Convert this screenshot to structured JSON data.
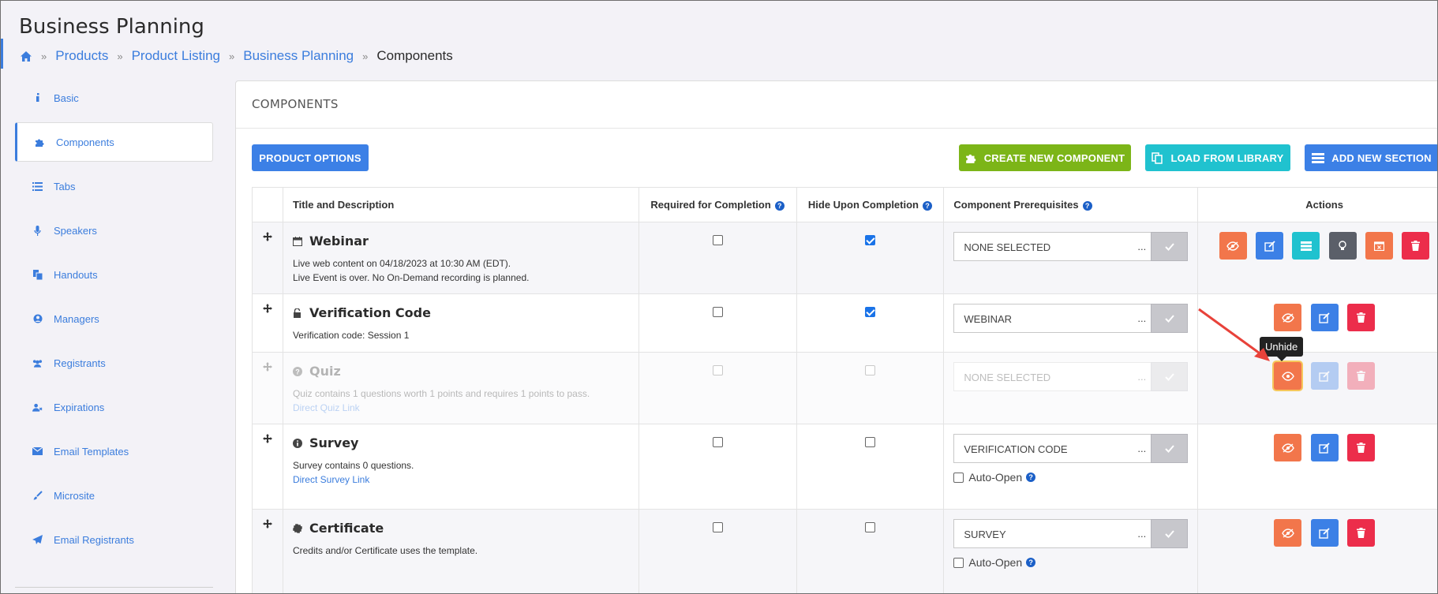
{
  "header": {
    "title": "Business Planning"
  },
  "breadcrumb": {
    "items": [
      "Products",
      "Product Listing",
      "Business Planning"
    ],
    "current": "Components"
  },
  "sidebar": {
    "items": [
      {
        "label": "Basic",
        "icon": "info-icon"
      },
      {
        "label": "Components",
        "icon": "puzzle-icon",
        "active": true
      },
      {
        "label": "Tabs",
        "icon": "list-icon"
      },
      {
        "label": "Speakers",
        "icon": "microphone-icon"
      },
      {
        "label": "Handouts",
        "icon": "copy-icon"
      },
      {
        "label": "Managers",
        "icon": "user-circle-icon"
      },
      {
        "label": "Registrants",
        "icon": "users-icon"
      },
      {
        "label": "Expirations",
        "icon": "user-times-icon"
      },
      {
        "label": "Email Templates",
        "icon": "envelope-icon"
      },
      {
        "label": "Microsite",
        "icon": "brush-icon"
      },
      {
        "label": "Email Registrants",
        "icon": "paper-plane-icon"
      }
    ]
  },
  "panel": {
    "title": "COMPONENTS"
  },
  "toolbar": {
    "product_options": "PRODUCT OPTIONS",
    "create_new": "CREATE NEW COMPONENT",
    "load_library": "LOAD FROM LIBRARY",
    "add_section": "ADD NEW SECTION"
  },
  "table": {
    "headers": {
      "title": "Title and Description",
      "required": "Required for Completion",
      "hide": "Hide Upon Completion",
      "prereq": "Component Prerequisites",
      "actions": "Actions"
    },
    "rows": [
      {
        "title": "Webinar",
        "desc1": "Live web content on 04/18/2023 at 10:30 AM (EDT).",
        "desc2": "Live Event is over. No On-Demand recording is planned.",
        "required": false,
        "hide": true,
        "prereq": "NONE SELECTED"
      },
      {
        "title": "Verification Code",
        "desc1": "Verification code: Session 1",
        "required": false,
        "hide": true,
        "prereq": "WEBINAR"
      },
      {
        "title": "Quiz",
        "desc1": "Quiz contains 1 questions worth 1 points and requires 1 points to pass.",
        "link": "Direct Quiz Link",
        "required": false,
        "hide": false,
        "prereq": "NONE SELECTED",
        "hidden": true
      },
      {
        "title": "Survey",
        "desc1": "Survey contains 0 questions.",
        "link": "Direct Survey Link",
        "required": false,
        "hide": false,
        "prereq": "VERIFICATION CODE",
        "auto_open": "Auto-Open"
      },
      {
        "title": "Certificate",
        "desc1": "Credits and/or Certificate uses the template.",
        "required": false,
        "hide": false,
        "prereq": "SURVEY",
        "auto_open": "Auto-Open"
      }
    ]
  },
  "tooltip": {
    "text": "Unhide"
  },
  "dots": "...",
  "help_glyph": "?",
  "colors": {
    "accent": "#3b7ddd",
    "create_green": "#7cb518",
    "library_teal": "#20c2cf",
    "add_blue": "#3c80e6",
    "annotation_arrow": "#e8423a"
  }
}
